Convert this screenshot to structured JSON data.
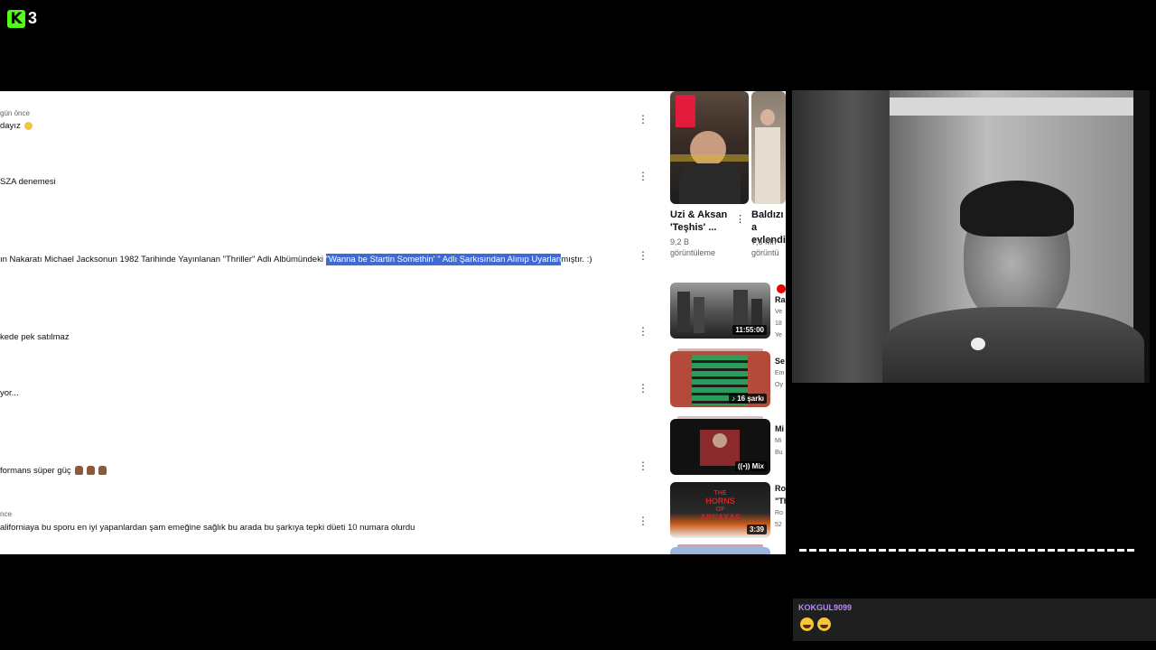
{
  "overlay": {
    "logo_letter": "K",
    "logo_number": "3"
  },
  "comments": [
    {
      "meta": "gün önce",
      "text": "dayız",
      "emoji": "sad"
    },
    {
      "meta": "",
      "text": "SZA denemesi"
    },
    {
      "meta": "",
      "text_before": "ın Nakaratı Michael Jacksonun 1982 Tarihinde Yayınlanan \"Thriller\" Adlı Albümündeki ",
      "text_highlight": "\"Wanna be Startin Somethin' \" Adlı Şarkısından Alınıp Uyarlan",
      "text_after": "mıştır. :)"
    },
    {
      "meta": "",
      "text": "kede pek satılmaz"
    },
    {
      "meta": "",
      "text": "yor..."
    },
    {
      "meta": "",
      "text": "formans süper güç",
      "emoji": "thumbs"
    },
    {
      "meta": "nce",
      "text": "aliforniaya bu sporu en iyi yapanlardan şam emeğine sağlık bu arada bu şarkıya tepki düeti 10 numara olurdu"
    }
  ],
  "shorts": [
    {
      "title": "Uzi & Aksan 'Teşhis' ...",
      "views_line1": "9,2 B",
      "views_line2": "görüntüleme"
    },
    {
      "title": "Baldızı a evlendin",
      "views_line1": "7,6 Mn",
      "views_line2": "görüntü"
    }
  ],
  "videos": [
    {
      "duration": "11:55:00",
      "side_title": "Ra",
      "side_sub1": "Ve",
      "side_sub2": "18",
      "side_sub3": "Ye"
    },
    {
      "duration": "♪ 16 şarkı",
      "side_title": "Se",
      "side_sub1": "Em",
      "side_sub2": "Oy"
    },
    {
      "duration": "((•)) Mix",
      "side_title": "Mi",
      "side_sub1": "Mi",
      "side_sub2": "Bu"
    },
    {
      "duration": "3:39",
      "side_title": "Ro",
      "side_title2": "\"Th",
      "side_sub1": "Ro",
      "side_sub2": "52",
      "thumb_text1": "THE",
      "thumb_text2": "HORNS",
      "thumb_text3": "OF",
      "thumb_text4": "ABNAXAS"
    }
  ],
  "chat": {
    "username": "KOKGUL9099"
  },
  "colors": {
    "highlight": "#3d6ad6",
    "kick_green": "#53fc18",
    "chat_user": "#b68cf0"
  }
}
